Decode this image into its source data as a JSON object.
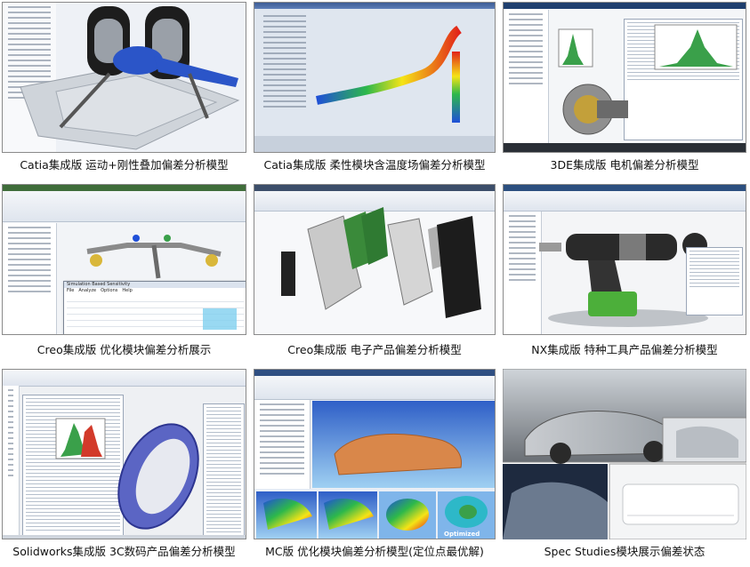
{
  "captions": [
    "Catia集成版 运动+刚性叠加偏差分析模型",
    "Catia集成版 柔性模块含温度场偏差分析模型",
    "3DE集成版 电机偏差分析模型",
    "Creo集成版 优化模块偏差分析展示",
    "Creo集成版 电子产品偏差分析模型",
    "NX集成版 特种工具产品偏差分析模型",
    "Solidworks集成版 3C数码产品偏差分析模型",
    "MC版  优化模块偏差分析模型(定位点最优解)",
    "Spec Studies模块展示偏差状态"
  ],
  "overlay_text": {
    "creo_table_window_title": "Simulation Based Sensitivity",
    "creo_table_menu": [
      "File",
      "Analyze",
      "Options",
      "Help"
    ],
    "mc_optimized_label": "Optimized"
  },
  "colors": {
    "window_titlebar": "#3b5b94",
    "heat_red": "#e2231a",
    "heat_yellow": "#f5e416",
    "heat_green": "#2db84b",
    "heat_blue": "#1f4fd8",
    "copper": "#d9874a",
    "histogram_green": "#3aa04a",
    "histogram_red": "#d23a2a"
  }
}
